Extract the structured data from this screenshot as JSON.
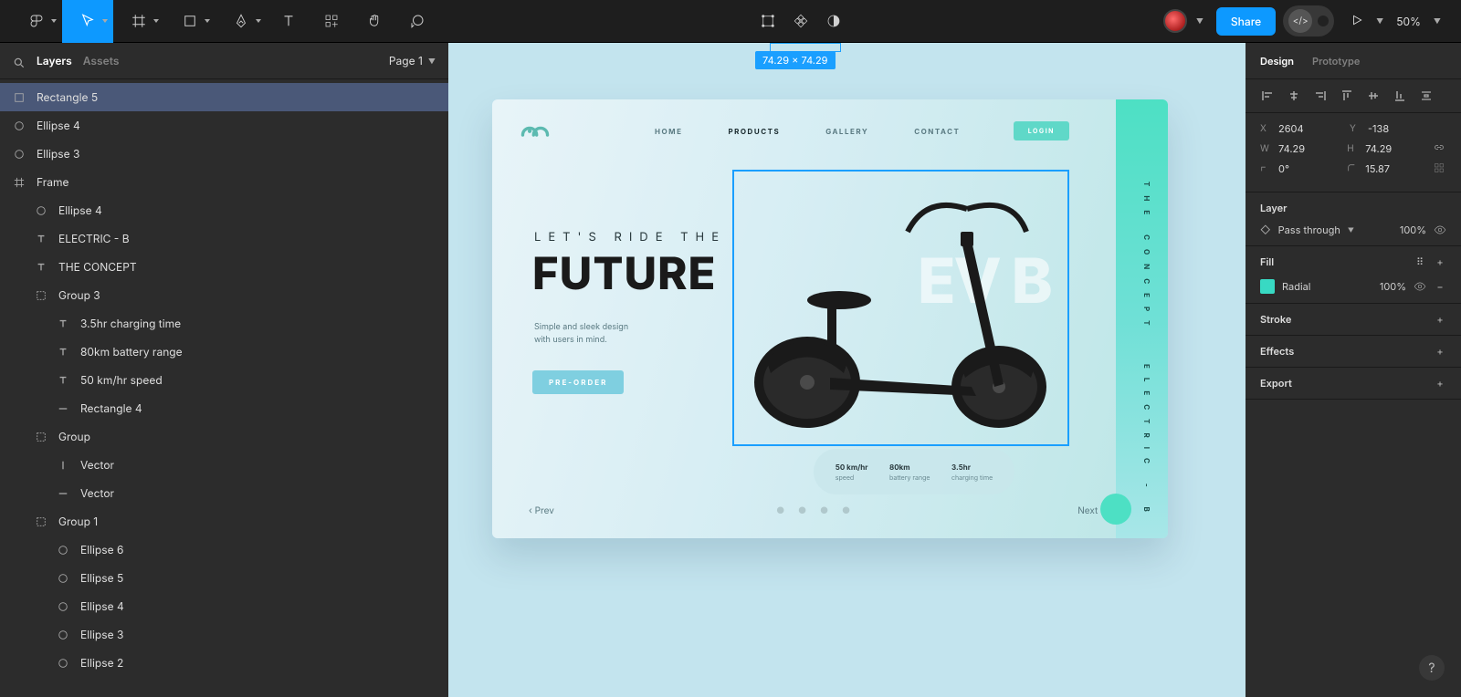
{
  "toolbar": {
    "share_label": "Share",
    "zoom": "50%"
  },
  "left_panel": {
    "tab_layers": "Layers",
    "tab_assets": "Assets",
    "page": "Page 1",
    "layers": [
      {
        "icon": "rect",
        "label": "Rectangle 5",
        "indent": 0,
        "selected": true
      },
      {
        "icon": "ellipse",
        "label": "Ellipse 4",
        "indent": 0
      },
      {
        "icon": "ellipse",
        "label": "Ellipse 3",
        "indent": 0
      },
      {
        "icon": "frame",
        "label": "Frame",
        "indent": 0
      },
      {
        "icon": "ellipse",
        "label": "Ellipse 4",
        "indent": 1
      },
      {
        "icon": "text",
        "label": "ELECTRIC - B",
        "indent": 1
      },
      {
        "icon": "text",
        "label": "THE CONCEPT",
        "indent": 1
      },
      {
        "icon": "group",
        "label": "Group 3",
        "indent": 1
      },
      {
        "icon": "text",
        "label": "3.5hr charging time",
        "indent": 2
      },
      {
        "icon": "text",
        "label": "80km battery range",
        "indent": 2
      },
      {
        "icon": "text",
        "label": "50 km/hr speed",
        "indent": 2
      },
      {
        "icon": "line",
        "label": "Rectangle 4",
        "indent": 2
      },
      {
        "icon": "group",
        "label": "Group",
        "indent": 1
      },
      {
        "icon": "vert",
        "label": "Vector",
        "indent": 2
      },
      {
        "icon": "line",
        "label": "Vector",
        "indent": 2
      },
      {
        "icon": "group",
        "label": "Group 1",
        "indent": 1
      },
      {
        "icon": "ellipse",
        "label": "Ellipse 6",
        "indent": 2
      },
      {
        "icon": "ellipse",
        "label": "Ellipse 5",
        "indent": 2
      },
      {
        "icon": "ellipse",
        "label": "Ellipse 4",
        "indent": 2
      },
      {
        "icon": "ellipse",
        "label": "Ellipse 3",
        "indent": 2
      },
      {
        "icon": "ellipse",
        "label": "Ellipse 2",
        "indent": 2
      }
    ]
  },
  "canvas": {
    "sel_label": "74.29 × 74.29",
    "artboard": {
      "nav": {
        "home": "HOME",
        "products": "PRODUCTS",
        "gallery": "GALLERY",
        "contact": "CONTACT"
      },
      "login": "LOGIN",
      "tagline": "LET'S RIDE THE",
      "hero": "FUTURE",
      "sub_l1": "Simple and sleek design",
      "sub_l2": "with users in mind.",
      "cta": "PRE-ORDER",
      "bg_text": "EV B",
      "sidebar_txt1": "THE CONCEPT",
      "sidebar_txt2": "ELECTRIC - B",
      "specs": [
        {
          "v": "50 km/hr",
          "l": "speed"
        },
        {
          "v": "80km",
          "l": "battery range"
        },
        {
          "v": "3.5hr",
          "l": "charging time"
        }
      ],
      "prev": "Prev",
      "next": "Next"
    }
  },
  "right_panel": {
    "tab_design": "Design",
    "tab_prototype": "Prototype",
    "transform": {
      "x_label": "X",
      "x": "2604",
      "y_label": "Y",
      "y": "-138",
      "w_label": "W",
      "w": "74.29",
      "h_label": "H",
      "h": "74.29",
      "rot_label": "",
      "rot": "0°",
      "rad_label": "",
      "rad": "15.87"
    },
    "layer_section": {
      "title": "Layer",
      "blend": "Pass through",
      "opacity": "100%"
    },
    "fill_section": {
      "title": "Fill",
      "type": "Radial",
      "opacity": "100%"
    },
    "stroke_title": "Stroke",
    "effects_title": "Effects",
    "export_title": "Export"
  }
}
